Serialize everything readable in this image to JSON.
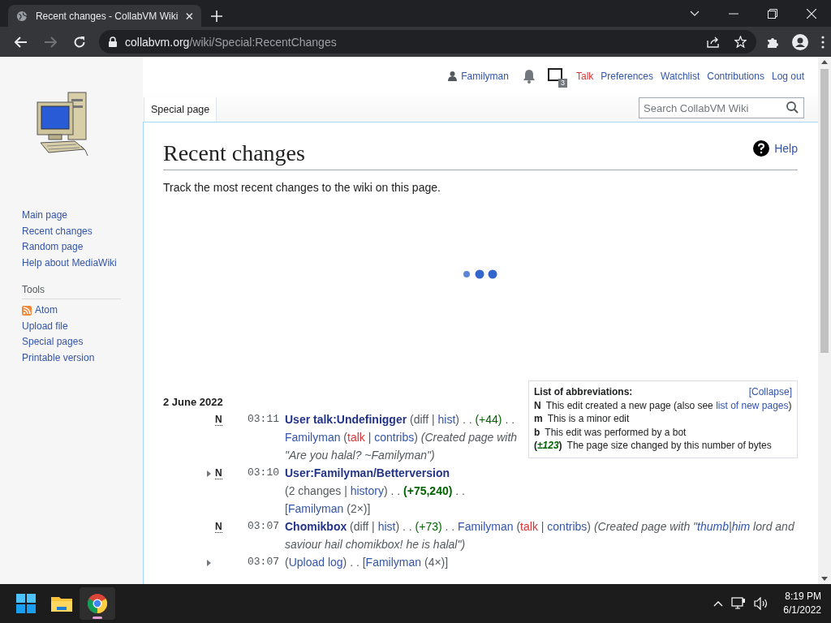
{
  "browser": {
    "tab_title": "Recent changes - CollabVM Wiki",
    "url_host": "collabvm.org",
    "url_path": "/wiki/Special:RecentChanges"
  },
  "personal": {
    "username": "Familyman",
    "notices_count": "3",
    "links": [
      {
        "label": "Talk",
        "kind": "missing"
      },
      {
        "label": "Preferences",
        "kind": "link"
      },
      {
        "label": "Watchlist",
        "kind": "link"
      },
      {
        "label": "Contributions",
        "kind": "link"
      },
      {
        "label": "Log out",
        "kind": "link"
      }
    ]
  },
  "namespace_tab": "Special page",
  "search": {
    "placeholder": "Search CollabVM Wiki"
  },
  "sidebar": {
    "navigation": [
      "Main page",
      "Recent changes",
      "Random page",
      "Help about MediaWiki"
    ],
    "tools_heading": "Tools",
    "tools": [
      {
        "label": "Atom",
        "kind": "feed"
      },
      {
        "label": "Upload file",
        "kind": "link"
      },
      {
        "label": "Special pages",
        "kind": "link"
      },
      {
        "label": "Printable version",
        "kind": "link"
      }
    ]
  },
  "page": {
    "title": "Recent changes",
    "help": "Help",
    "description": "Track the most recent changes to the wiki on this page."
  },
  "abbreviations": {
    "title": "List of abbreviations:",
    "toggle": "[Collapse]",
    "items": [
      {
        "key": [
          {
            "kind": "key",
            "text": "N"
          }
        ],
        "text": [
          {
            "kind": "plain",
            "text": "This edit created a new page (also see "
          },
          {
            "kind": "link",
            "text": "list of new pages"
          },
          {
            "kind": "plain",
            "text": ")"
          }
        ]
      },
      {
        "key": [
          {
            "kind": "key",
            "text": "m"
          }
        ],
        "text": [
          {
            "kind": "plain",
            "text": "This is a minor edit"
          }
        ]
      },
      {
        "key": [
          {
            "kind": "key",
            "text": "b"
          }
        ],
        "text": [
          {
            "kind": "plain",
            "text": "This edit was performed by a bot"
          }
        ]
      },
      {
        "key": [
          {
            "kind": "key",
            "text": "("
          },
          {
            "kind": "size_key",
            "text": "±123"
          },
          {
            "kind": "key",
            "text": ")"
          }
        ],
        "text": [
          {
            "kind": "plain",
            "text": "The page size changed by this number of bytes"
          }
        ]
      }
    ]
  },
  "date": "2 June 2022",
  "changes": [
    {
      "expandable": false,
      "flag": "N",
      "time": "03:11",
      "lines": [
        [
          {
            "kind": "title",
            "text": "User talk:Undefinigger"
          },
          {
            "kind": "plain",
            "text": " (diff | "
          },
          {
            "kind": "link",
            "text": "hist"
          },
          {
            "kind": "plain",
            "text": ") . . "
          },
          {
            "kind": "size",
            "text": "(+44)"
          },
          {
            "kind": "plain",
            "text": " . . "
          },
          {
            "kind": "link",
            "text": "Familyman"
          },
          {
            "kind": "plain",
            "text": " ("
          },
          {
            "kind": "missing",
            "text": "talk"
          },
          {
            "kind": "plain",
            "text": " | "
          },
          {
            "kind": "link",
            "text": "contribs"
          },
          {
            "kind": "plain",
            "text": ") "
          },
          {
            "kind": "comment",
            "text": "(Created page with \"Are you halal? ~Familyman\")"
          }
        ]
      ]
    },
    {
      "expandable": true,
      "flag": "N",
      "time": "03:10",
      "lines": [
        [
          {
            "kind": "title",
            "text": "User:Familyman/Betterversion"
          }
        ],
        [
          {
            "kind": "plain",
            "text": "(2 changes | "
          },
          {
            "kind": "link",
            "text": "history"
          },
          {
            "kind": "plain",
            "text": ") . . "
          },
          {
            "kind": "size_big",
            "text": "(+75,240)"
          },
          {
            "kind": "plain",
            "text": " . ."
          }
        ],
        [
          {
            "kind": "plain",
            "text": "["
          },
          {
            "kind": "link",
            "text": "Familyman"
          },
          {
            "kind": "plain",
            "text": " (2×)]"
          }
        ]
      ]
    },
    {
      "expandable": false,
      "flag": "N",
      "time": "03:07",
      "lines": [
        [
          {
            "kind": "title",
            "text": "Chomikbox"
          },
          {
            "kind": "plain",
            "text": " (diff | "
          },
          {
            "kind": "link",
            "text": "hist"
          },
          {
            "kind": "plain",
            "text": ") . . "
          },
          {
            "kind": "size",
            "text": "(+73)"
          },
          {
            "kind": "plain",
            "text": " . . "
          },
          {
            "kind": "link",
            "text": "Familyman"
          },
          {
            "kind": "plain",
            "text": " ("
          },
          {
            "kind": "missing",
            "text": "talk"
          },
          {
            "kind": "plain",
            "text": " | "
          },
          {
            "kind": "link",
            "text": "contribs"
          },
          {
            "kind": "plain",
            "text": ") "
          },
          {
            "kind": "comment",
            "text": "(Created page with \""
          },
          {
            "kind": "comment_link",
            "text": "thumb"
          },
          {
            "kind": "comment",
            "text": "|"
          },
          {
            "kind": "comment_link",
            "text": "him"
          },
          {
            "kind": "comment",
            "text": " lord and saviour hail chomikbox! he is halal\")"
          }
        ]
      ]
    },
    {
      "expandable": true,
      "time": "03:07",
      "lines": [
        [
          {
            "kind": "plain",
            "text": "("
          },
          {
            "kind": "link",
            "text": "Upload log"
          },
          {
            "kind": "plain",
            "text": ") . . ["
          },
          {
            "kind": "link",
            "text": "Familyman"
          },
          {
            "kind": "plain",
            "text": " (4×)]"
          }
        ]
      ]
    }
  ],
  "taskbar": {
    "time": "8:19 PM",
    "date": "6/1/2022"
  }
}
